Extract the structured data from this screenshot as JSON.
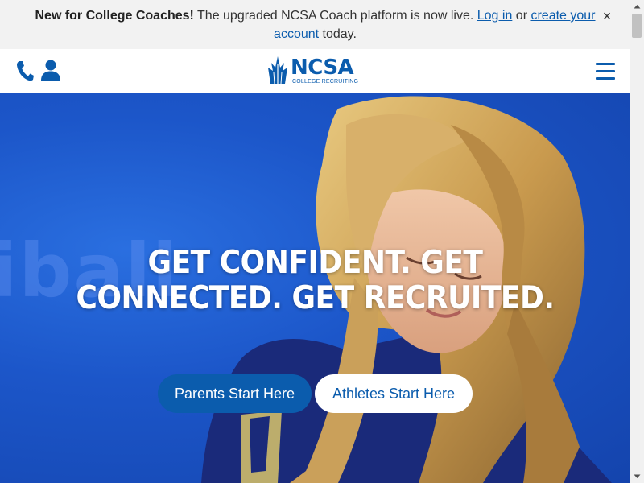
{
  "banner": {
    "lead": "New for College Coaches!",
    "text_before": " The upgraded NCSA Coach platform is now live. ",
    "login_link": "Log in",
    "text_or": " or ",
    "create_link": "create your account",
    "text_after": " today.",
    "close_label": "×"
  },
  "header": {
    "icons": [
      "phone-icon",
      "user-icon",
      "hamburger-menu-icon"
    ],
    "logo": {
      "wordmark": "NCSA",
      "tagline": "COLLEGE RECRUITING"
    }
  },
  "hero": {
    "headline": "GET CONFIDENT. GET CONNECTED. GET RECRUITED.",
    "parents_button": "Parents Start Here",
    "athletes_button": "Athletes Start Here"
  },
  "colors": {
    "brand_blue": "#0b5cad",
    "hero_blue": "#1c56c9",
    "banner_bg": "#f2f2f2"
  }
}
